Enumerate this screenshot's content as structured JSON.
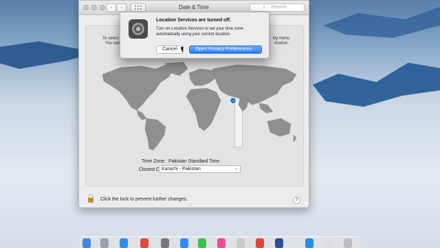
{
  "window": {
    "title": "Date & Time",
    "search_placeholder": "Search",
    "nav_back": "‹",
    "nav_forward": "›"
  },
  "panel": {
    "side_left_1": "To select",
    "side_left_2": "You can",
    "side_right_1": "lity menu.",
    "side_right_2": "ocation.",
    "time_zone_label": "Time Zone:",
    "time_zone_value": "Pakistan Standard Time",
    "closest_city_label": "Closest City:",
    "closest_city_value": "Karachi - Pakistan"
  },
  "footer": {
    "lock_text": "Click the lock to prevent further changes.",
    "help": "?"
  },
  "alert": {
    "title": "Location Services are turned off.",
    "message": "Turn on Location Services to set your time zone automatically using your current location.",
    "cancel_label": "Cancel",
    "open_label": "Open Privacy Preferences..."
  },
  "colors": {
    "accent": "#2b7cf2",
    "pin": "#2f7ad8",
    "map_land": "#8f8f8f"
  },
  "icons": [
    "gear-icon",
    "lock-icon",
    "search-icon",
    "help-icon",
    "grid-icon"
  ],
  "dock": {
    "icons": [
      "finder-icon",
      "launchpad-icon",
      "safari-icon",
      "calendar-icon",
      "preferences-icon",
      "appstore-icon",
      "messages-icon",
      "itunes-icon",
      "photos-icon",
      "chrome-icon",
      "appstore2-icon",
      "safari2-icon",
      "print-icon",
      "trash-icon"
    ]
  }
}
